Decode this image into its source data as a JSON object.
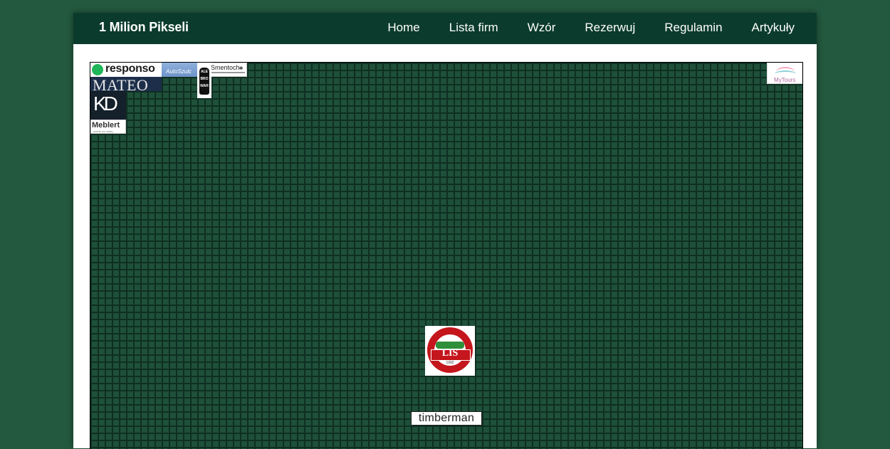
{
  "navbar": {
    "brand": "1 Milion Pikseli",
    "links": [
      "Home",
      "Lista firm",
      "Wzór",
      "Rezerwuj",
      "Regulamin",
      "Artykuły"
    ]
  },
  "grid": {
    "ads": {
      "responso": "responso",
      "autoszulc": "AutoSzulc",
      "smentoch": "Smentoch",
      "alebrowar": [
        "ALE",
        "BRO",
        "WAR"
      ],
      "mateo": "MATEO",
      "kd": "KD",
      "meblert": "Meblert",
      "meblert_sub": "meble na miarę",
      "mytours": "MyTours",
      "lis": "LIS",
      "lis_top": "PRZETWÓRSTWO MIĘSNE",
      "lis_bottom": "SIERAKOWICE",
      "lis_year": "1992",
      "timberman": "timberman"
    }
  },
  "colors": {
    "page_bg": "#235a3f",
    "navbar_bg": "#0b3b2c",
    "grid_cell": "#1e503a",
    "grid_line": "#0f2f22"
  }
}
